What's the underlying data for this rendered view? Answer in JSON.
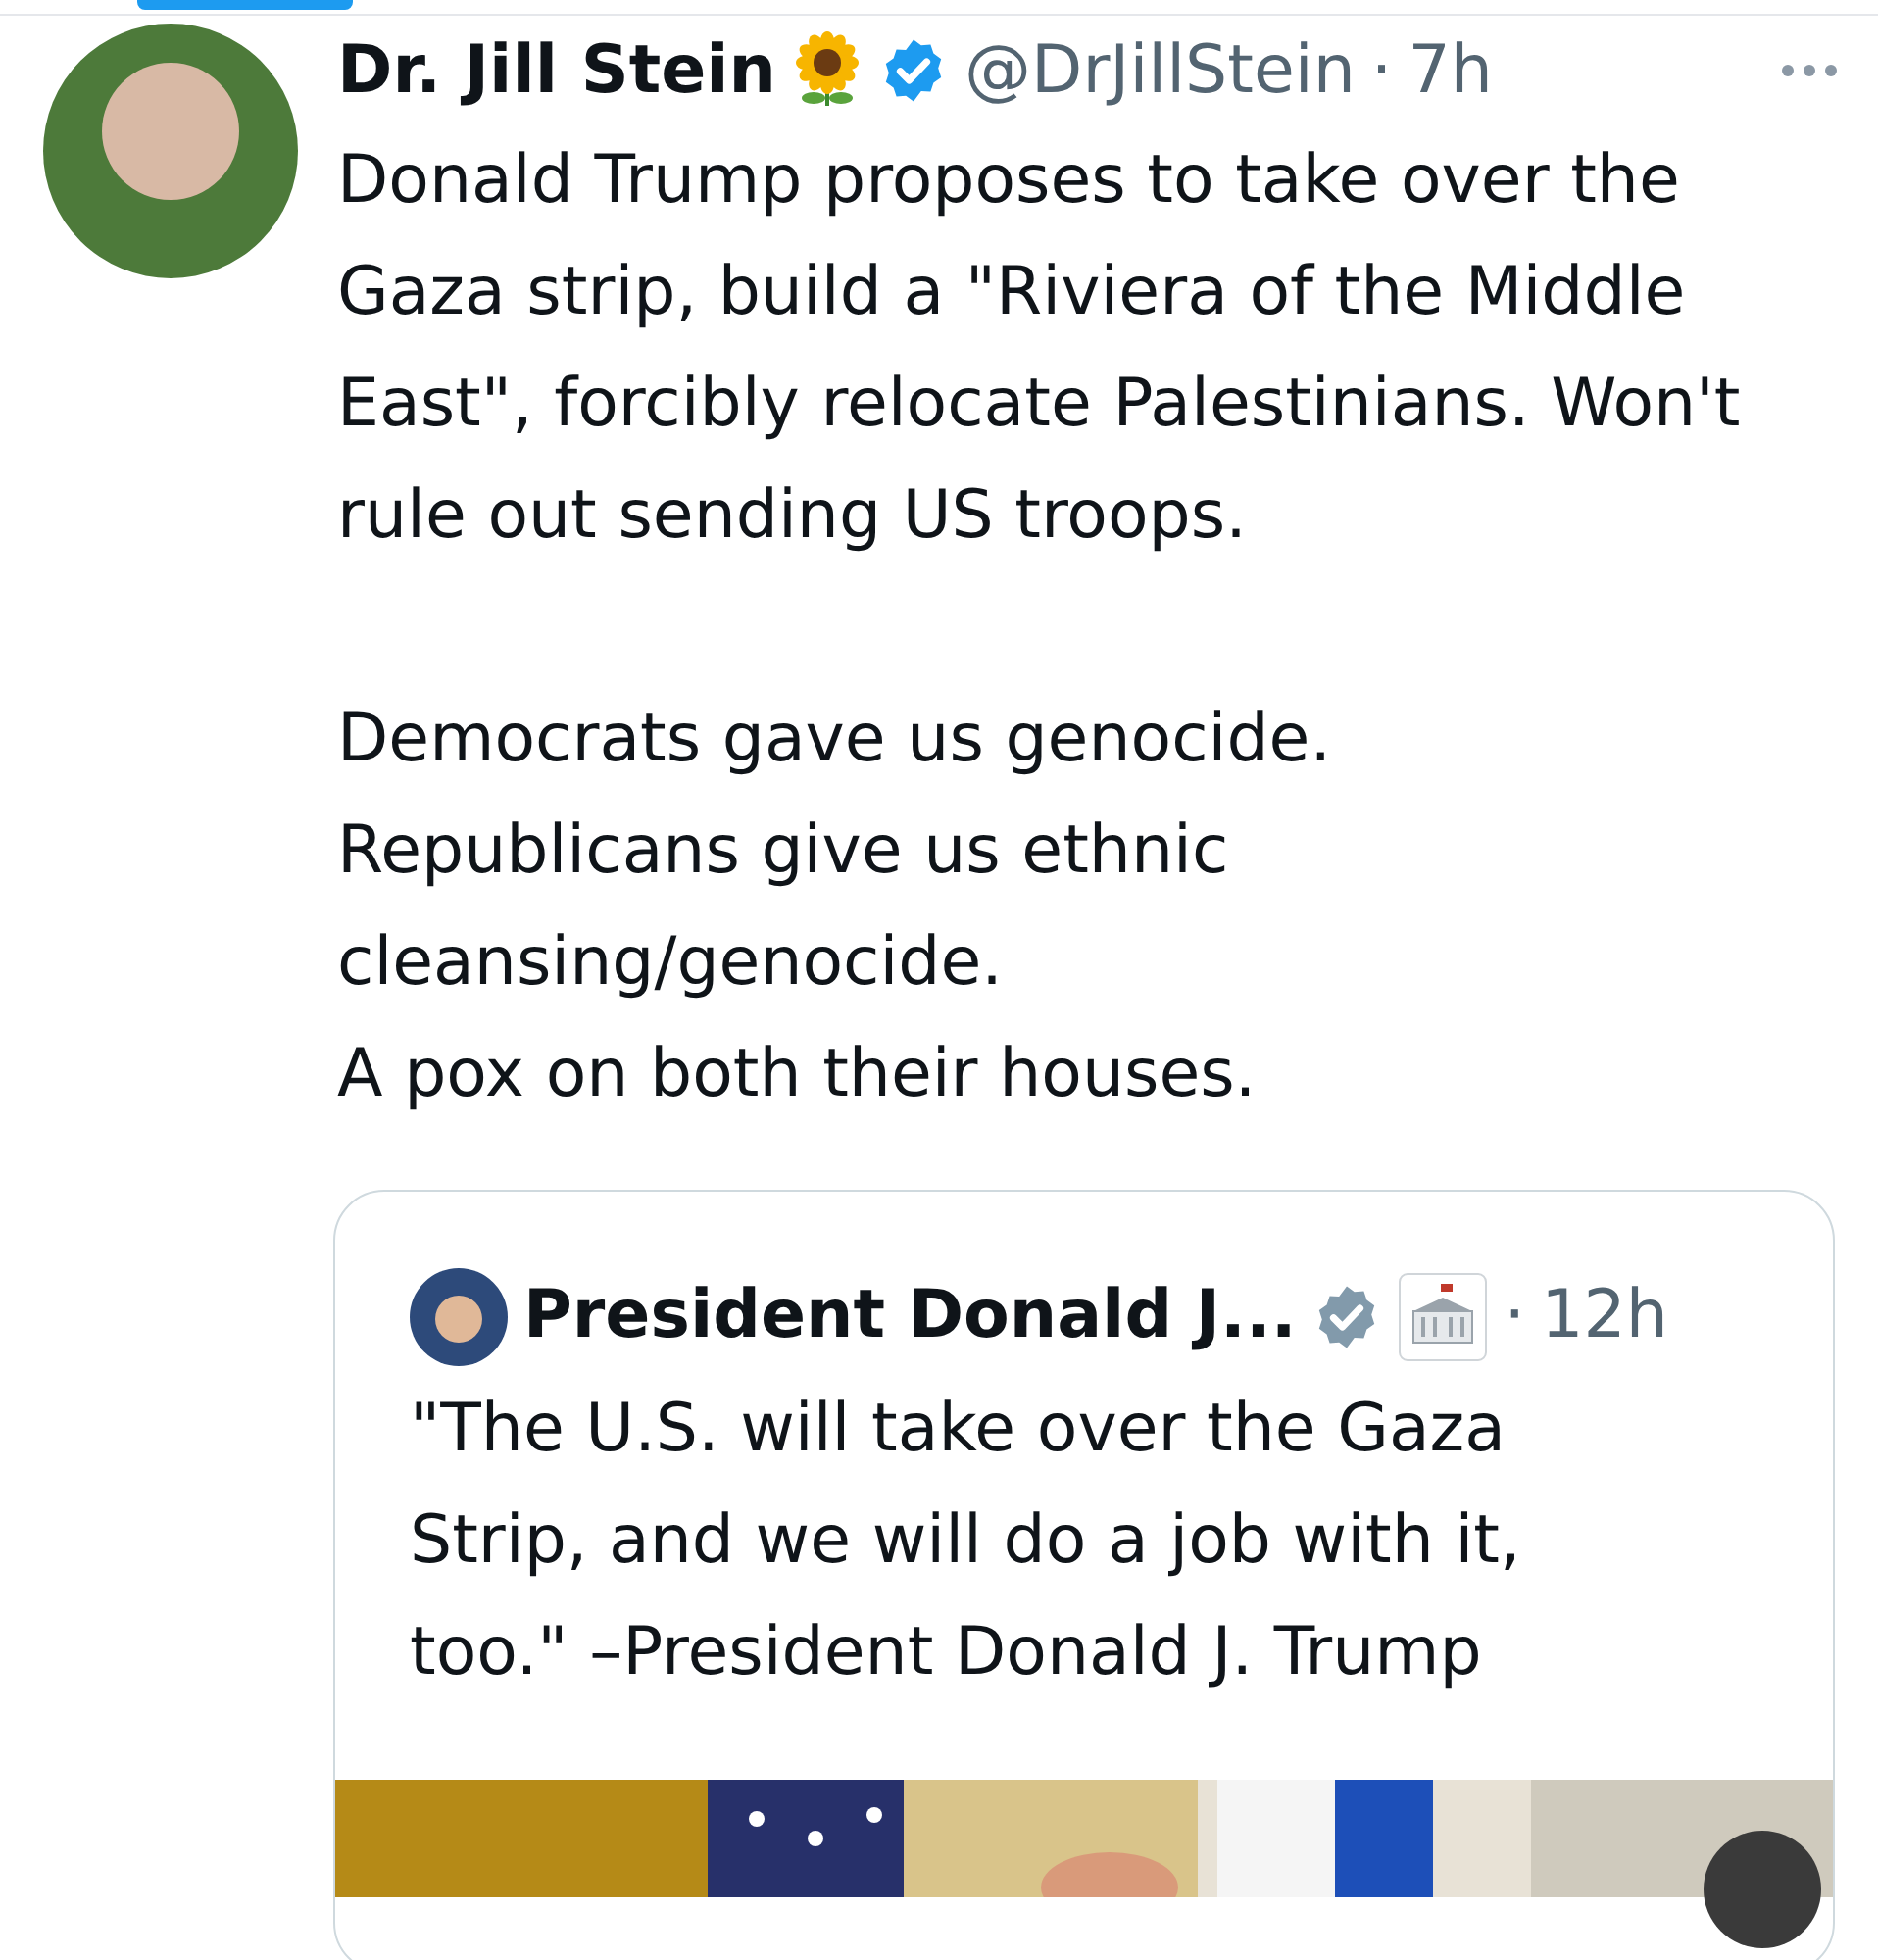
{
  "tweet": {
    "name": "Dr. Jill Stein",
    "handle": "@DrJillStein",
    "separator": "·",
    "time": "7h",
    "paragraphs": [
      "Donald Trump proposes to take over the Gaza strip, build a \"Riviera of the Middle East\", forcibly relocate Palestinians. Won't rule out sending US troops.",
      "Democrats gave us genocide.",
      "Republicans give us ethnic cleansing/genocide.",
      "A pox on both their houses."
    ]
  },
  "quote": {
    "name": "President Donald J...",
    "separator": "·",
    "time": "12h",
    "text": "\"The U.S. will take over the Gaza Strip, and we will do a job with it, too.\" –President Donald J. Trump"
  }
}
